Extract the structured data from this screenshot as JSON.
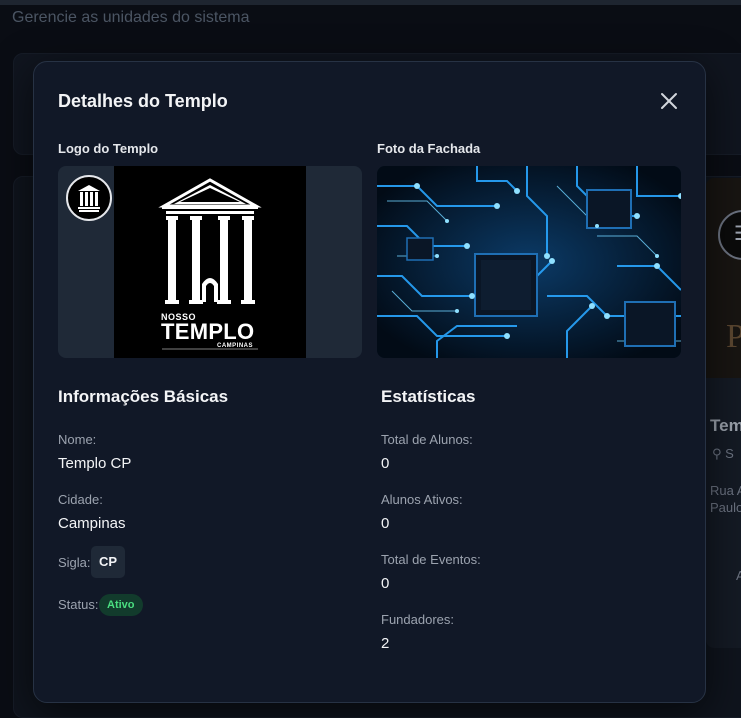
{
  "background": {
    "subtitle": "Gerencie as unidades do sistema",
    "card_title_partial": "Tem",
    "card_location_partial": "S",
    "card_address_line1_partial": "Rua A",
    "card_address_line2_partial": "Paulo",
    "card_action_partial": "A"
  },
  "modal": {
    "title": "Detalhes do Templo",
    "close_icon": "close-icon",
    "logo_label": "Logo do Templo",
    "photo_label": "Foto da Fachada",
    "logo": {
      "word_small": "NOSSO",
      "word_big": "TEMPLO",
      "word_city": "CAMPINAS"
    },
    "basic_info": {
      "title": "Informações Básicas",
      "name_label": "Nome:",
      "name_value": "Templo CP",
      "city_label": "Cidade:",
      "city_value": "Campinas",
      "sigla_label": "Sigla:",
      "sigla_value": "CP",
      "status_label": "Status:",
      "status_value": "Ativo"
    },
    "stats": {
      "title": "Estatísticas",
      "total_students_label": "Total de Alunos:",
      "total_students_value": "0",
      "active_students_label": "Alunos Ativos:",
      "active_students_value": "0",
      "total_events_label": "Total de Eventos:",
      "total_events_value": "0",
      "founders_label": "Fundadores:",
      "founders_value": "2"
    }
  },
  "colors": {
    "modal_bg": "#111827",
    "status_green": "#4ade80",
    "circuit_blue": "#3ab6ff"
  }
}
